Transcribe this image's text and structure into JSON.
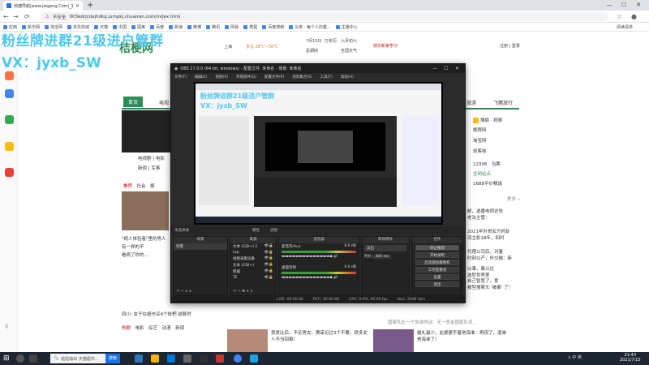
{
  "browser": {
    "tab_title": "快捷导航|www.jiegeng.Com|_官",
    "address": "003edrjcdejhdkg.jumpkj.chuairan.com/index.html",
    "insecure_label": "不安全",
    "bookmarks": [
      "应用",
      "新华网",
      "淘宝网",
      "京东商城",
      "天猫",
      "中国",
      "国美",
      "百度",
      "新浪",
      "微博",
      "腾讯",
      "网易",
      "携程",
      "百度搜索",
      "头条 · 每个人的重...",
      "主播中心"
    ],
    "bookmarks_right": "阅读清单"
  },
  "watermark": {
    "line1": "粉丝牌进群21级进户管群",
    "line2": "VX：jyxb_SW"
  },
  "site": {
    "logo": "桔梗网",
    "city": "上海",
    "weather": "多云 28℃~36℃",
    "date": "7月15日",
    "lunar": "六月初六",
    "week": "星期四",
    "weather_link": "全国天气",
    "calendar": "万年历",
    "login": "注册 | 登录",
    "notice": "快乐新家学习",
    "nav_tabs": [
      "首页",
      "电视",
      "旅游",
      "飞猪旅行"
    ],
    "hot_links": [
      "电视剧",
      "电影",
      "新闻",
      "军事"
    ],
    "sub_tabs": [
      "推荐",
      "社会",
      "娱"
    ],
    "right_items": [
      "搜狐 · 视频",
      "携程网",
      "淘宝网",
      "创客帖",
      "12306 · 当票",
      "全网站点",
      "1688平价精选"
    ],
    "more": "更多 »",
    "news_left": [
      "\"病人体验者\"里的男人",
      "有一样的不",
      "看病了你的..."
    ],
    "bottom_tabs": [
      "热剧",
      "电影",
      "综艺",
      "动漫",
      "新闻"
    ],
    "news_bottom": [
      "国家队比一个你讲的话：无一奖金国家队发...",
      "恩爱比后，不论男女，赛审记过3个不要，很多女人不当回事！",
      "婚礼最少，此婆婆手着他海准：再现了，遣弟他海准了！"
    ],
    "news_right": [
      "邮，选番电视访吃",
      "老法主管：",
      "2021年外贵女方时卦",
      "流主影18年，四时",
      "代理公司后，对着",
      "时刻以产，外交融：新",
      "以事，离以过",
      "选型世界里",
      "自己智慧了，意",
      "被型搜索头 '被离' 了！"
    ],
    "left_text": [
      "四川: 女子在超市买4个枇杷",
      "结账时"
    ]
  },
  "obs": {
    "title": "OBS 27.0.0 (64 bit, windows) - 配置文件: 未命名 - 场景: 未命名",
    "menus": [
      "文件(F)",
      "编辑(E)",
      "视图(V)",
      "停靠部件(D)",
      "配置文件(P)",
      "场景集合(S)",
      "工具(T)",
      "帮助(H)"
    ],
    "scene_label": "未选择源",
    "scene_props": [
      "属性",
      "滤镜"
    ],
    "dock_scenes": "场景",
    "dock_sources": "来源",
    "dock_mixer": "混音器",
    "dock_transitions": "转场特效",
    "dock_controls": "控件",
    "scene_item": "场景",
    "sources": [
      "文本 (GDI+) 2",
      "Lsp",
      "视频采集设备",
      "文本 (GDI+)",
      "摇器",
      "TE"
    ],
    "mixer": [
      {
        "name": "麦克风/Aux",
        "db": "0.0 dB"
      },
      {
        "name": "桌面音频",
        "db": "0.0 dB"
      }
    ],
    "transition": "淡出",
    "duration_label": "时长",
    "duration": "300 ms",
    "controls": [
      "停止推流",
      "开始录制",
      "启动虚拟摄像机",
      "工作室模式",
      "设置",
      "退出"
    ],
    "status": [
      "LIVE: 00:00:00",
      "REC: 00:00:00",
      "CPU: 0.0%, 60.00 fps",
      "kb/s: 2500 kb/s"
    ]
  },
  "taskbar": {
    "search_placeholder": "粘贴输出 天猫超市...",
    "search_button": "搜索",
    "tray": "∧ 中 英",
    "time": "21:43",
    "date": "2021/7/15"
  },
  "colors": {
    "accent": "#2e8b57",
    "watermark": "#4cc9f0",
    "obs_bg": "#2b2b2b"
  }
}
